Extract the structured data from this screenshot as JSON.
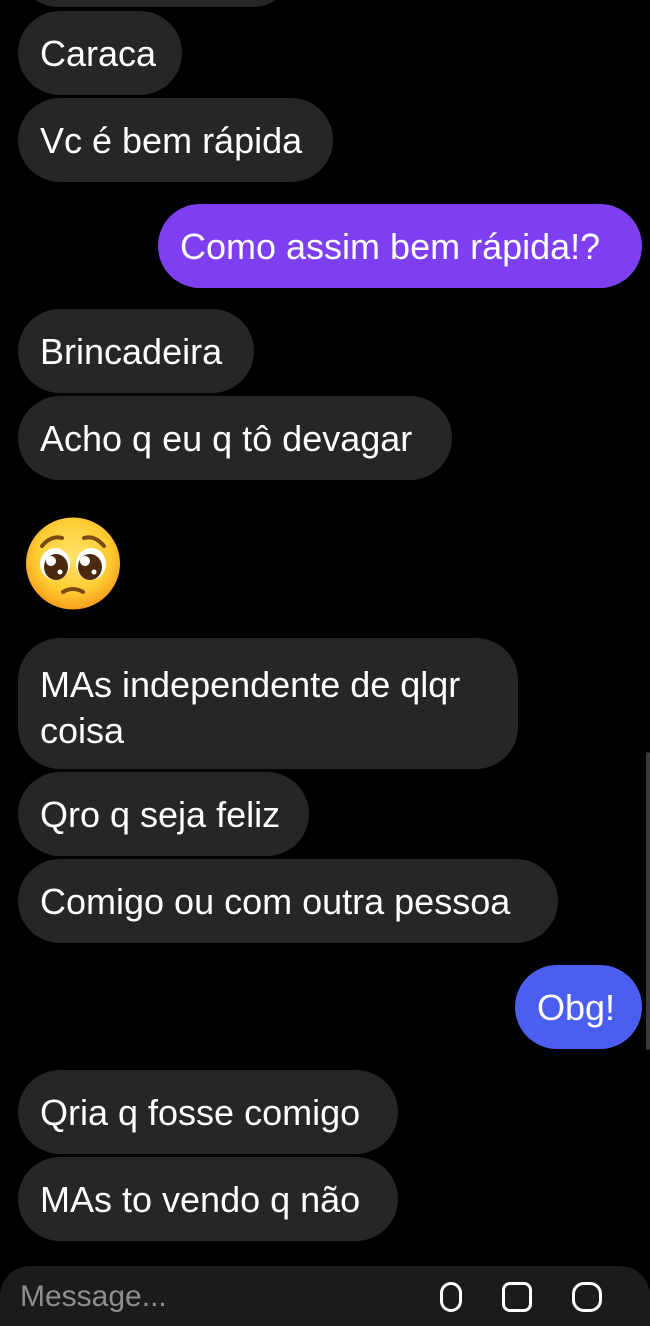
{
  "messages": [
    {
      "text": "Caraca",
      "direction": "received"
    },
    {
      "text": "Vc é bem rápida",
      "direction": "received"
    },
    {
      "text": "Como assim bem rápida!?",
      "direction": "sent"
    },
    {
      "text": "Brincadeira",
      "direction": "received"
    },
    {
      "text": "Acho q eu q tô devagar",
      "direction": "received"
    },
    {
      "text": "🥺",
      "direction": "received",
      "type": "emoji",
      "icon": "pleading-face-emoji"
    },
    {
      "text": "MAs independente de qlqr coisa",
      "direction": "received"
    },
    {
      "text": "Qro q seja feliz",
      "direction": "received"
    },
    {
      "text": "Comigo ou com outra pessoa",
      "direction": "received"
    },
    {
      "text": "Obg!",
      "direction": "sent"
    },
    {
      "text": "Qria q fosse comigo",
      "direction": "received"
    },
    {
      "text": "MAs to vendo q não",
      "direction": "received"
    }
  ],
  "composer": {
    "placeholder": "Message...",
    "icons": [
      "microphone-icon",
      "gallery-icon",
      "sticker-icon"
    ]
  },
  "colors": {
    "background": "#000000",
    "received_bubble": "#262626",
    "sent_bubble_top": "#7e3ff2",
    "sent_bubble_bottom": "#4a5ff0",
    "text": "#ffffff"
  }
}
